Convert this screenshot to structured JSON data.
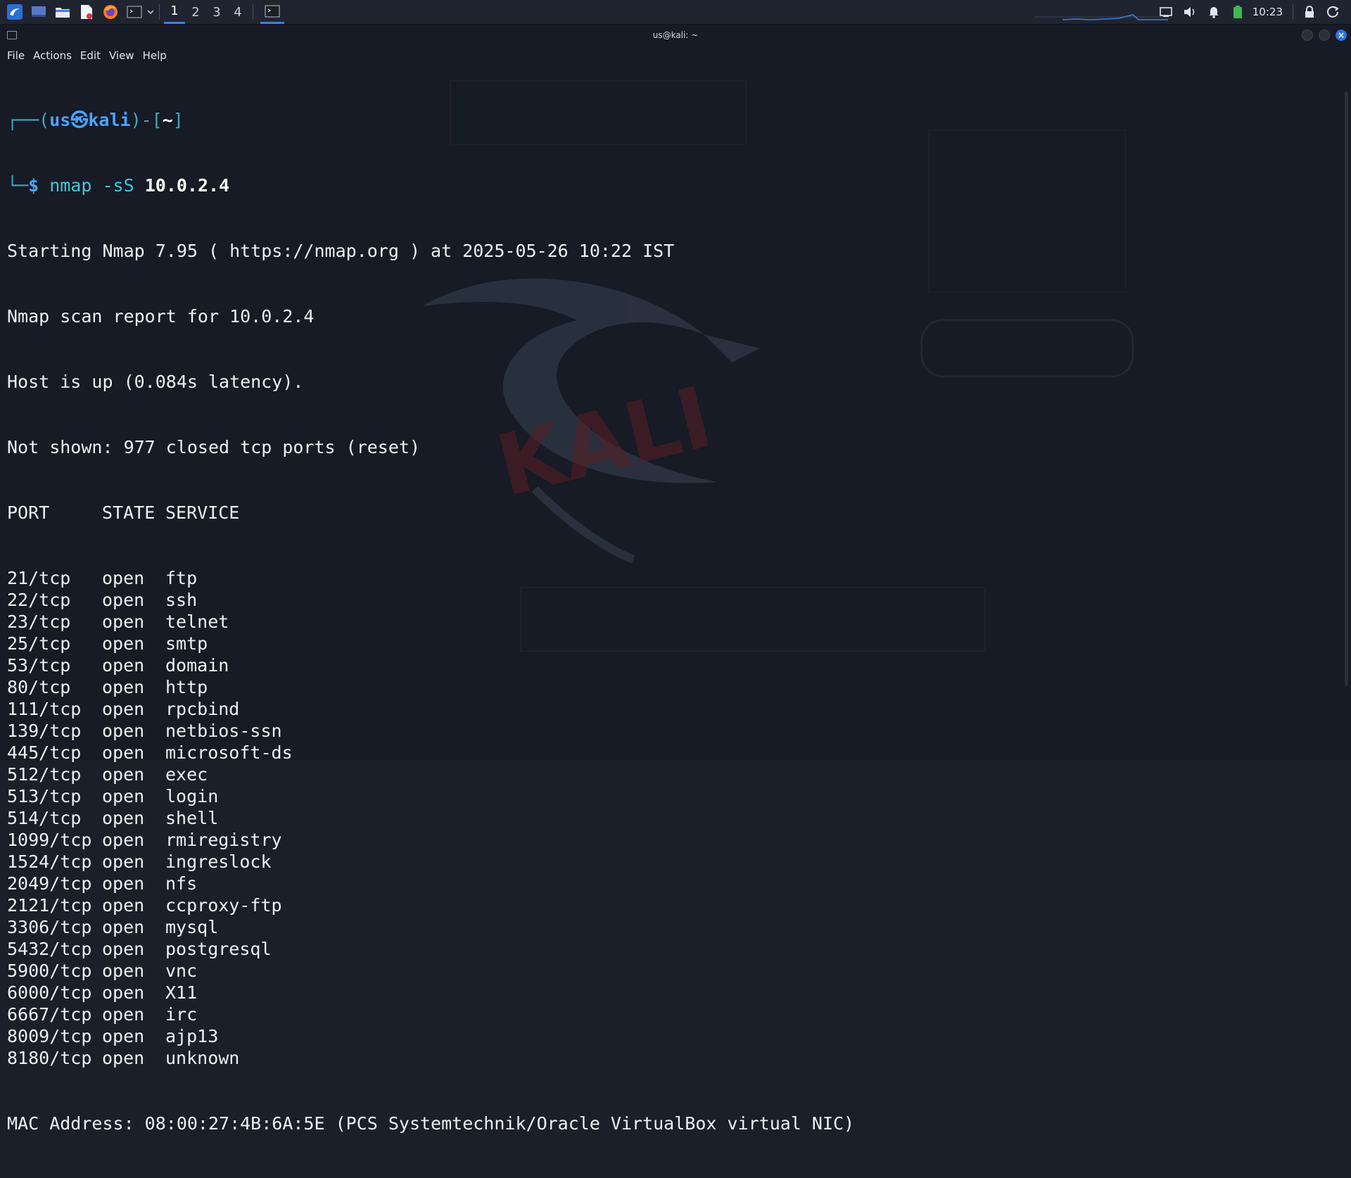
{
  "taskbar": {
    "workspaces": [
      "1",
      "2",
      "3",
      "4"
    ],
    "clock": "10:23"
  },
  "window": {
    "title": "us@kali: ~",
    "menu": [
      "File",
      "Actions",
      "Edit",
      "View",
      "Help"
    ]
  },
  "prompt": {
    "user": "us",
    "host": "kali",
    "dir": "~",
    "command": "nmap",
    "flag": "-sS",
    "target": "10.0.2.4"
  },
  "output": {
    "header": [
      "Starting Nmap 7.95 ( https://nmap.org ) at 2025-05-26 10:22 IST",
      "Nmap scan report for 10.0.2.4",
      "Host is up (0.084s latency).",
      "Not shown: 977 closed tcp ports (reset)"
    ],
    "columns": [
      "PORT",
      "STATE",
      "SERVICE"
    ],
    "rows": [
      [
        "21/tcp",
        "open",
        "ftp"
      ],
      [
        "22/tcp",
        "open",
        "ssh"
      ],
      [
        "23/tcp",
        "open",
        "telnet"
      ],
      [
        "25/tcp",
        "open",
        "smtp"
      ],
      [
        "53/tcp",
        "open",
        "domain"
      ],
      [
        "80/tcp",
        "open",
        "http"
      ],
      [
        "111/tcp",
        "open",
        "rpcbind"
      ],
      [
        "139/tcp",
        "open",
        "netbios-ssn"
      ],
      [
        "445/tcp",
        "open",
        "microsoft-ds"
      ],
      [
        "512/tcp",
        "open",
        "exec"
      ],
      [
        "513/tcp",
        "open",
        "login"
      ],
      [
        "514/tcp",
        "open",
        "shell"
      ],
      [
        "1099/tcp",
        "open",
        "rmiregistry"
      ],
      [
        "1524/tcp",
        "open",
        "ingreslock"
      ],
      [
        "2049/tcp",
        "open",
        "nfs"
      ],
      [
        "2121/tcp",
        "open",
        "ccproxy-ftp"
      ],
      [
        "3306/tcp",
        "open",
        "mysql"
      ],
      [
        "5432/tcp",
        "open",
        "postgresql"
      ],
      [
        "5900/tcp",
        "open",
        "vnc"
      ],
      [
        "6000/tcp",
        "open",
        "X11"
      ],
      [
        "6667/tcp",
        "open",
        "irc"
      ],
      [
        "8009/tcp",
        "open",
        "ajp13"
      ],
      [
        "8180/tcp",
        "open",
        "unknown"
      ]
    ],
    "mac": "MAC Address: 08:00:27:4B:6A:5E (PCS Systemtechnik/Oracle VirtualBox virtual NIC)"
  },
  "colors": {
    "accent": "#3d7fe0",
    "background": "#161b25",
    "prompt": "#4aa3ff"
  }
}
